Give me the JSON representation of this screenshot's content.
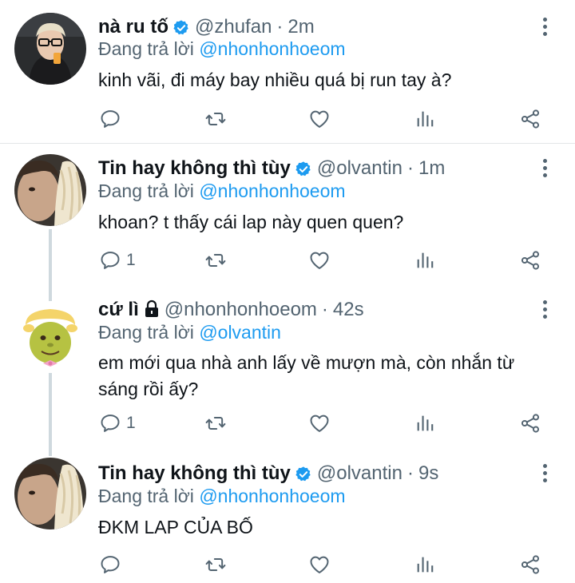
{
  "tweets": [
    {
      "name": "nà ru tố",
      "handle": "@zhufan",
      "sep": "·",
      "time": "2m",
      "reply_prefix": "Đang trả lời",
      "reply_to": "@nhonhonhoeom",
      "text": "kinh vãi, đi máy bay nhiều quá bị run tay à?",
      "reply_count": "",
      "verified": true
    },
    {
      "name": "Tin hay không thì tùy",
      "handle": "@olvantin",
      "sep": "·",
      "time": "1m",
      "reply_prefix": "Đang trả lời",
      "reply_to": "@nhonhonhoeom",
      "text": "khoan? t thấy cái lap này quen quen?",
      "reply_count": "1",
      "verified": true
    },
    {
      "name": "cứ lì",
      "handle": "@nhonhonhoeom",
      "sep": "·",
      "time": "42s",
      "reply_prefix": "Đang trả lời",
      "reply_to": "@olvantin",
      "text": "em mới qua nhà anh lấy về mượn mà, còn nhắn từ sáng rồi ấy?",
      "reply_count": "1",
      "protected": true
    },
    {
      "name": "Tin hay không thì tùy",
      "handle": "@olvantin",
      "sep": "·",
      "time": "9s",
      "reply_prefix": "Đang trả lời",
      "reply_to": "@nhonhonhoeom",
      "text": "ĐKM LAP CỦA BỐ",
      "reply_count": "",
      "verified": true
    }
  ],
  "icons": {
    "reply": "reply-icon",
    "retweet": "retweet-icon",
    "like": "like-icon",
    "views": "views-icon",
    "share": "share-icon",
    "more": "more-icon",
    "verified": "verified-badge-icon",
    "protected": "lock-icon"
  },
  "colors": {
    "accent": "#1d9bf0",
    "secondary_text": "#536471",
    "thread_line": "#cfd9de"
  }
}
